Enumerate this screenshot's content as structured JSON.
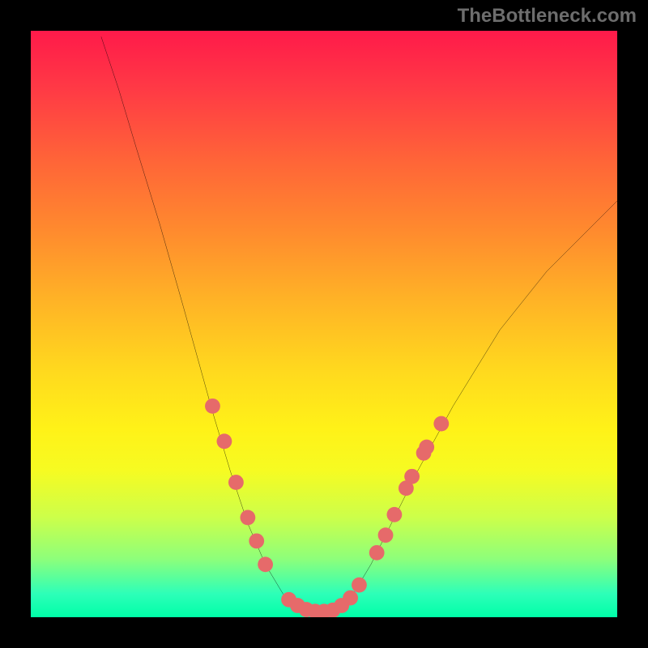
{
  "watermark": "TheBottleneck.com",
  "chart_data": {
    "type": "line",
    "title": "",
    "xlabel": "",
    "ylabel": "",
    "xlim": [
      0,
      100
    ],
    "ylim": [
      0,
      100
    ],
    "curve": {
      "name": "bottleneck-curve",
      "points": [
        {
          "x": 12,
          "y": 99
        },
        {
          "x": 15,
          "y": 90
        },
        {
          "x": 18,
          "y": 80
        },
        {
          "x": 22,
          "y": 67
        },
        {
          "x": 26,
          "y": 53
        },
        {
          "x": 31,
          "y": 35
        },
        {
          "x": 34,
          "y": 25
        },
        {
          "x": 37,
          "y": 16
        },
        {
          "x": 40,
          "y": 9
        },
        {
          "x": 43,
          "y": 4
        },
        {
          "x": 46,
          "y": 1.5
        },
        {
          "x": 49,
          "y": 1
        },
        {
          "x": 52,
          "y": 1.5
        },
        {
          "x": 55,
          "y": 4
        },
        {
          "x": 58,
          "y": 9
        },
        {
          "x": 62,
          "y": 17
        },
        {
          "x": 66,
          "y": 25
        },
        {
          "x": 72,
          "y": 36
        },
        {
          "x": 80,
          "y": 49
        },
        {
          "x": 88,
          "y": 59
        },
        {
          "x": 96,
          "y": 67
        },
        {
          "x": 100,
          "y": 71
        }
      ]
    },
    "markers": {
      "name": "highlight-points",
      "color": "#e66a6a",
      "points": [
        {
          "x": 31,
          "y": 36
        },
        {
          "x": 33,
          "y": 30
        },
        {
          "x": 35,
          "y": 23
        },
        {
          "x": 37,
          "y": 17
        },
        {
          "x": 38.5,
          "y": 13
        },
        {
          "x": 40,
          "y": 9
        },
        {
          "x": 44,
          "y": 3
        },
        {
          "x": 45.5,
          "y": 2
        },
        {
          "x": 47,
          "y": 1.3
        },
        {
          "x": 48.5,
          "y": 1
        },
        {
          "x": 50,
          "y": 1
        },
        {
          "x": 51.5,
          "y": 1.2
        },
        {
          "x": 53,
          "y": 2
        },
        {
          "x": 54.5,
          "y": 3.3
        },
        {
          "x": 56,
          "y": 5.5
        },
        {
          "x": 59,
          "y": 11
        },
        {
          "x": 60.5,
          "y": 14
        },
        {
          "x": 62,
          "y": 17.5
        },
        {
          "x": 64,
          "y": 22
        },
        {
          "x": 65,
          "y": 24
        },
        {
          "x": 67,
          "y": 28
        },
        {
          "x": 67.5,
          "y": 29
        },
        {
          "x": 70,
          "y": 33
        }
      ]
    }
  }
}
